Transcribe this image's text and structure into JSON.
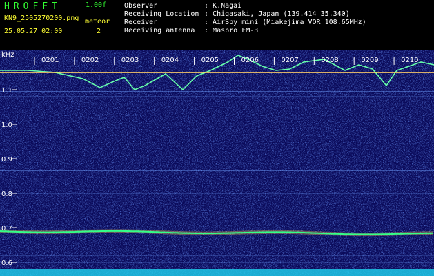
{
  "header": {
    "logo": "HROFFT",
    "version": "1.00f",
    "filename": "KN9_2505270200.png",
    "meteor_label": "meteor",
    "meteor_count": "2",
    "datetime": "25.05.27 02:00"
  },
  "meta": [
    {
      "label": "Observer",
      "value": "K.Nagai"
    },
    {
      "label": "Receiving Location",
      "value": "Chigasaki, Japan (139.414 35.340)"
    },
    {
      "label": "Receiver",
      "value": "AirSpy mini (Miakejima VOR 108.65MHz)"
    },
    {
      "label": "Receiving antenna",
      "value": "Maspro FM-3"
    }
  ],
  "spectrogram": {
    "unit": "kHz",
    "y_ticks": [
      "1.1",
      "1.0",
      "0.9",
      "0.8",
      "0.7",
      "0.6"
    ],
    "y_values": [
      1.1,
      1.0,
      0.9,
      0.8,
      0.7,
      0.6
    ],
    "y_range": [
      0.58,
      1.17
    ],
    "time_labels": [
      "0201",
      "0202",
      "0203",
      "0204",
      "0205",
      "0206",
      "0207",
      "0208",
      "0209",
      "0210"
    ],
    "colors": {
      "background": "#0a0a5a",
      "signal": "#33ff88",
      "noise": "#2a50c8"
    }
  }
}
